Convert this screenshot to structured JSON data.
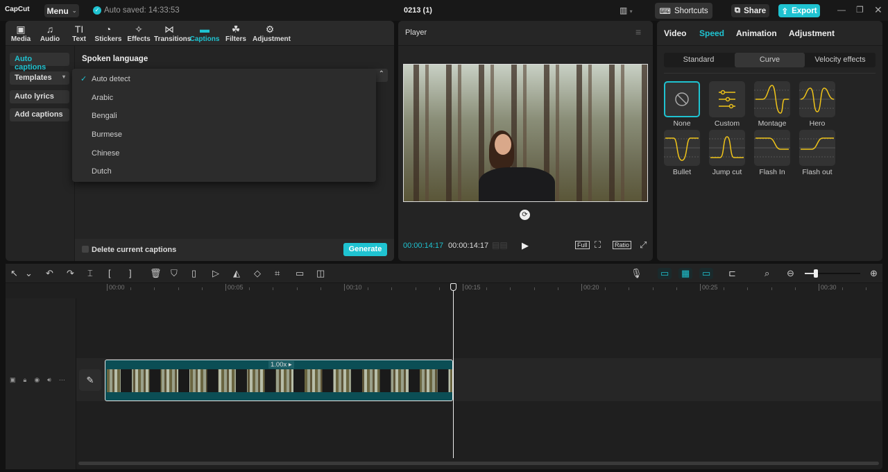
{
  "app": {
    "logo": "CapCut",
    "menu": "Menu",
    "autosave": "Auto saved: 14:33:53",
    "project": "0213 (1)",
    "shortcuts": "Shortcuts",
    "share": "Share",
    "export": "Export"
  },
  "colors": {
    "accent": "#1fc3d1",
    "curve": "#f0c419",
    "clip": "#0b4e55"
  },
  "tabs": [
    {
      "label": "Media",
      "icon": "media-icon"
    },
    {
      "label": "Audio",
      "icon": "audio-icon"
    },
    {
      "label": "Text",
      "icon": "text-icon"
    },
    {
      "label": "Stickers",
      "icon": "stickers-icon"
    },
    {
      "label": "Effects",
      "icon": "effects-icon"
    },
    {
      "label": "Transitions",
      "icon": "transitions-icon"
    },
    {
      "label": "Captions",
      "icon": "captions-icon"
    },
    {
      "label": "Filters",
      "icon": "filters-icon"
    },
    {
      "label": "Adjustment",
      "icon": "adjustment-icon"
    }
  ],
  "captions": {
    "sidebar": [
      "Auto captions",
      "Templates",
      "Auto lyrics",
      "Add captions"
    ],
    "spoken_language_label": "Spoken language",
    "languages": [
      "Auto detect",
      "Arabic",
      "Bengali",
      "Burmese",
      "Chinese",
      "Dutch"
    ],
    "selected": "Auto detect",
    "delete_label": "Delete current captions",
    "generate": "Generate"
  },
  "player": {
    "title": "Player",
    "current_time": "00:00:14:17",
    "total_time": "00:00:14:17",
    "full": "Full",
    "ratio": "Ratio"
  },
  "inspector": {
    "tabs": [
      "Video",
      "Speed",
      "Animation",
      "Adjustment"
    ],
    "active_tab": "Speed",
    "segments": [
      "Standard",
      "Curve",
      "Velocity effects"
    ],
    "active_segment": "Curve",
    "curves": [
      "None",
      "Custom",
      "Montage",
      "Hero",
      "Bullet",
      "Jump cut",
      "Flash In",
      "Flash out"
    ],
    "selected_curve": "None"
  },
  "timeline": {
    "ticks": [
      "00:00",
      "00:05",
      "00:10",
      "00:15",
      "00:20",
      "00:25",
      "00:30"
    ],
    "clip_speed": "1.00x",
    "playhead_seconds": 14.7,
    "zoom_level": 0.2
  }
}
